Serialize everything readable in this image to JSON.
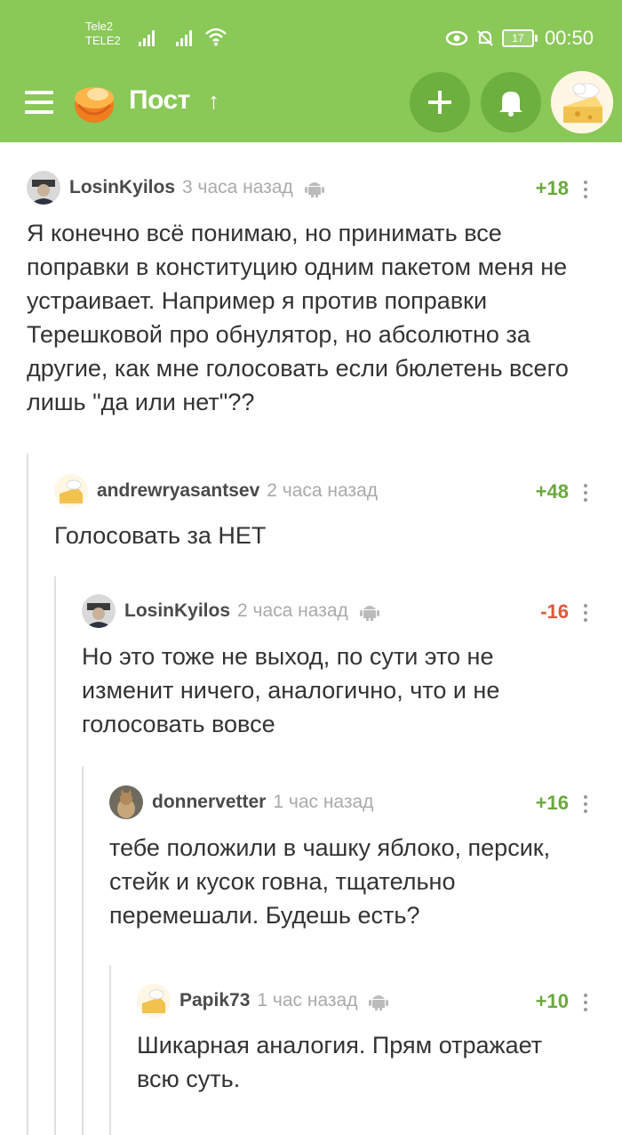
{
  "status_bar": {
    "carrier1": "Tele2",
    "carrier2": "TELE2",
    "battery": "17",
    "time": "00:50"
  },
  "app_bar": {
    "title": "Пост",
    "icons": [
      "menu-icon",
      "pikabu-logo",
      "arrow-up-icon",
      "plus-icon",
      "bell-icon",
      "user-avatar"
    ],
    "accent": "#8ac858"
  },
  "comments": [
    {
      "user": "LosinKyilos",
      "time": "3 часа назад",
      "rating": "+18",
      "text": "Я конечно всё понимаю, но принимать все поправки в конституцию одним пакетом меня не устраивает. Например я против поправки Терешковой про обнулятор, но абсолютно за другие, как мне голосовать если бюлетень всего лишь \"да или нет\"??"
    },
    {
      "user": "andrewryasantsev",
      "time": "2 часа назад",
      "rating": "+48",
      "text": "Голосовать за НЕТ"
    },
    {
      "user": "LosinKyilos",
      "time": "2 часа назад",
      "rating": "-16",
      "text": "Но это тоже не выход, по сути это не изменит ничего, аналогично, что и не голосовать вовсе"
    },
    {
      "user": "donnervetter",
      "time": "1 час назад",
      "rating": "+16",
      "text": "тебе положили в чашку яблоко, персик, стейк и кусок говна, тщательно перемешали. Будешь есть?"
    },
    {
      "user": "Papik73",
      "time": "1 час назад",
      "rating": "+10",
      "text": "Шикарная аналогия. Прям отражает всю суть."
    }
  ],
  "colors": {
    "positive": "#6aa83c",
    "negative": "#e0573a",
    "thread_line": "#e0e0e0"
  }
}
